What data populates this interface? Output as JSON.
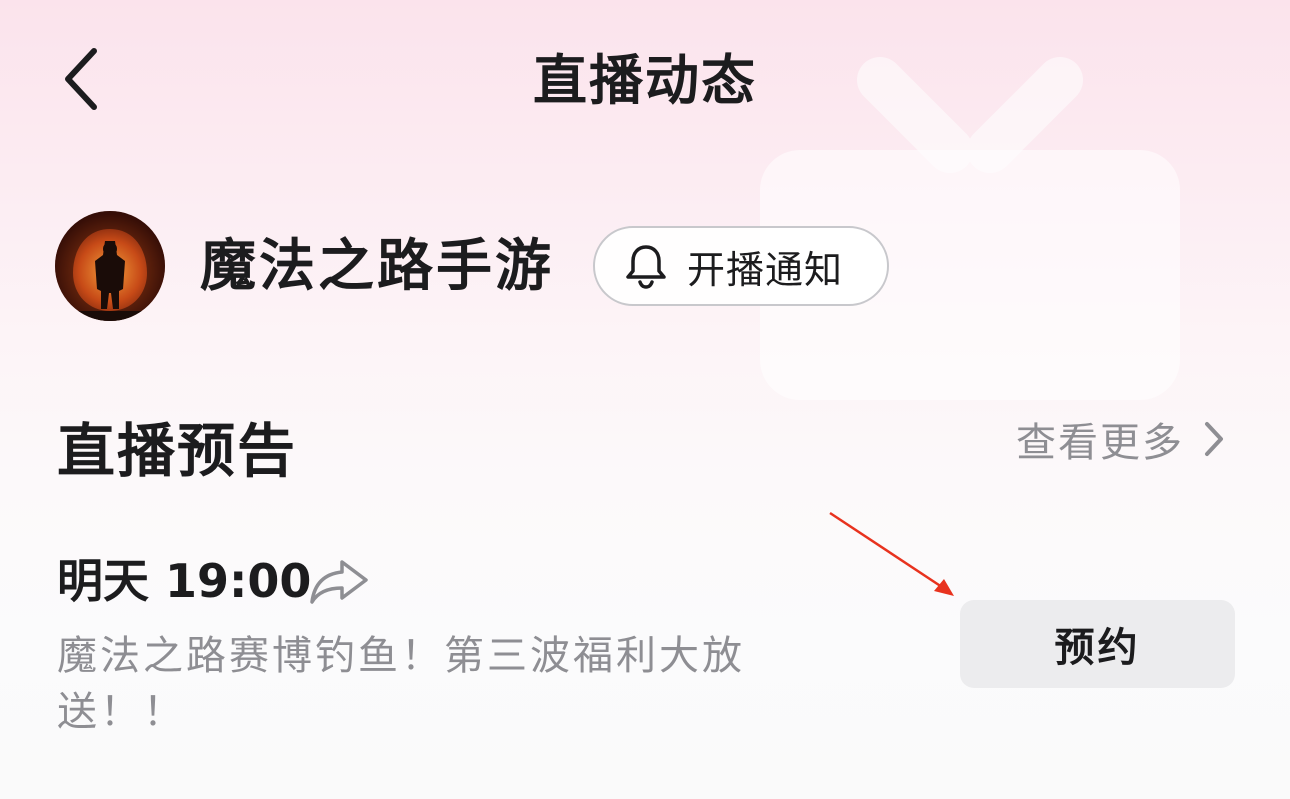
{
  "header": {
    "title": "直播动态",
    "back_icon": "chevron-left-icon"
  },
  "channel": {
    "name": "魔法之路手游",
    "notify_label": "开播通知",
    "notify_icon": "bell-icon"
  },
  "section": {
    "title": "直播预告",
    "see_more_label": "查看更多",
    "see_more_icon": "chevron-right-icon"
  },
  "event": {
    "time": "明天 19:00",
    "share_icon": "share-arrow-icon",
    "description": "魔法之路赛博钓鱼！第三波福利大放送！！",
    "reserve_label": "预约"
  },
  "colors": {
    "title_text": "#1c1c1e",
    "secondary_text": "#8e8e93",
    "reserve_button_bg": "#ececee",
    "annotation_arrow": "#e8321e",
    "background_top": "#fbe3ec"
  }
}
